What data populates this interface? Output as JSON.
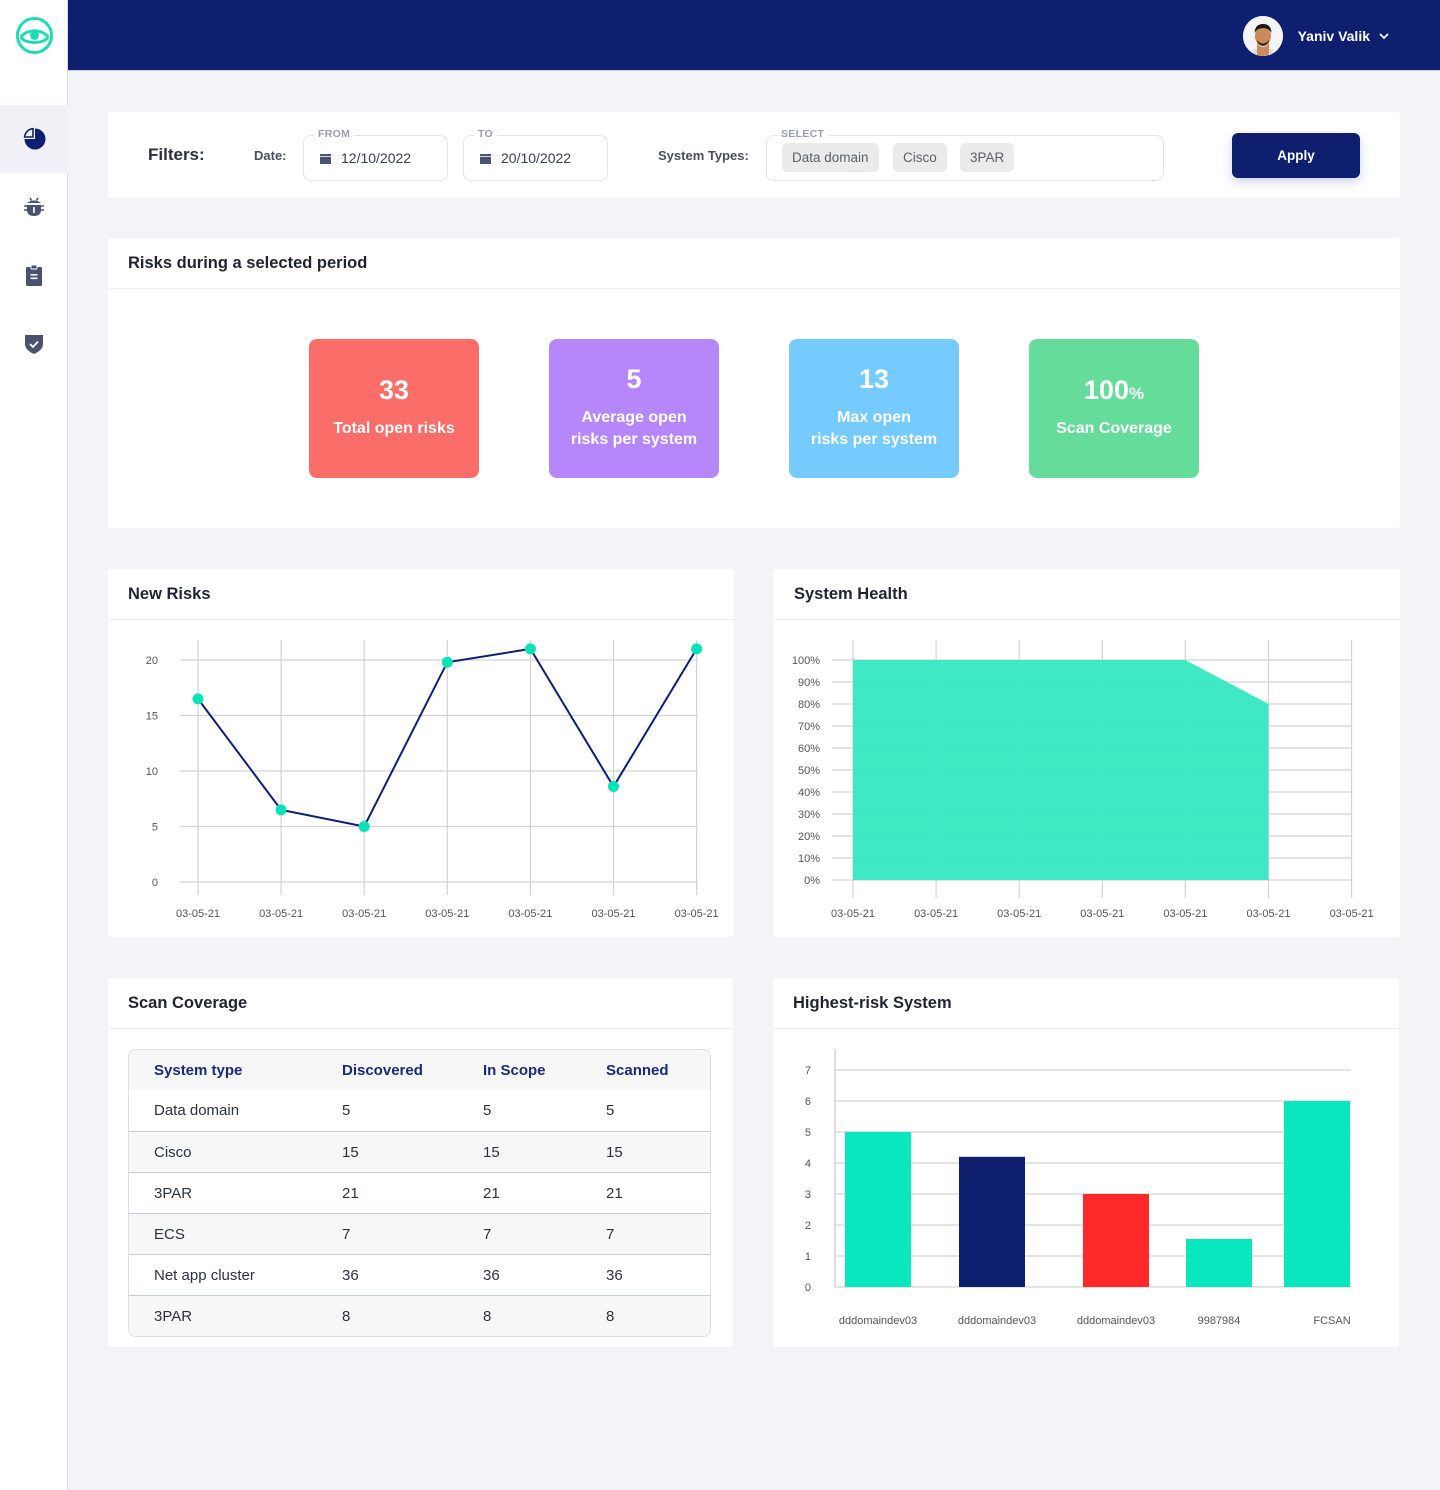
{
  "app": {
    "sidebar": {
      "items": [
        {
          "name": "dashboard",
          "icon": "pie-chart-icon",
          "active": true
        },
        {
          "name": "vulnerabilities",
          "icon": "bug-icon",
          "active": false
        },
        {
          "name": "reports",
          "icon": "clipboard-icon",
          "active": false
        },
        {
          "name": "compliance",
          "icon": "shield-check-icon",
          "active": false
        }
      ]
    },
    "user": {
      "name": "Yaniv Valik"
    }
  },
  "filters": {
    "title": "Filters:",
    "date_label": "Date:",
    "from_legend": "FROM",
    "from_value": "12/10/2022",
    "to_legend": "TO",
    "to_value": "20/10/2022",
    "system_types_label": "System Types:",
    "select_legend": "SELECT",
    "chips": [
      "Data domain",
      "Cisco",
      "3PAR"
    ],
    "apply_label": "Apply"
  },
  "risks": {
    "title": "Risks during a selected period",
    "stats": [
      {
        "value": "33",
        "unit": "",
        "label_line1": "Total open risks",
        "label_line2": "",
        "color": "#fa6d68"
      },
      {
        "value": "5",
        "unit": "",
        "label_line1": "Average open",
        "label_line2": "risks per system",
        "color": "#b687fa"
      },
      {
        "value": "13",
        "unit": "",
        "label_line1": "Max open",
        "label_line2": "risks per system",
        "color": "#76cbfe"
      },
      {
        "value": "100",
        "unit": "%",
        "label_line1": "Scan Coverage",
        "label_line2": "",
        "color": "#66dc9a"
      }
    ]
  },
  "new_risks": {
    "title": "New Risks"
  },
  "system_health": {
    "title": "System Health"
  },
  "scan_coverage": {
    "title": "Scan Coverage",
    "columns": [
      "System type",
      "Discovered",
      "In Scope",
      "Scanned"
    ],
    "rows": [
      [
        "Data domain",
        "5",
        "5",
        "5"
      ],
      [
        "Cisco",
        "15",
        "15",
        "15"
      ],
      [
        "3PAR",
        "21",
        "21",
        "21"
      ],
      [
        "ECS",
        "7",
        "7",
        "7"
      ],
      [
        "Net app cluster",
        "36",
        "36",
        "36"
      ],
      [
        "3PAR",
        "8",
        "8",
        "8"
      ]
    ]
  },
  "highest_risk": {
    "title": "Highest-risk System"
  },
  "chart_data": [
    {
      "id": "new_risks",
      "type": "line",
      "title": "New Risks",
      "categories": [
        "03-05-21",
        "03-05-21",
        "03-05-21",
        "03-05-21",
        "03-05-21",
        "03-05-21",
        "03-05-21"
      ],
      "values": [
        16.5,
        6.5,
        5,
        19.8,
        21,
        8.6,
        21
      ],
      "yticks": [
        0,
        5,
        10,
        15,
        20
      ],
      "ylim": [
        0,
        20
      ],
      "grid": true,
      "line_color": "#0f1f70",
      "marker_color": "#08e2b8"
    },
    {
      "id": "system_health",
      "type": "area",
      "title": "System Health",
      "categories": [
        "03-05-21",
        "03-05-21",
        "03-05-21",
        "03-05-21",
        "03-05-21",
        "03-05-21",
        "03-05-21"
      ],
      "values": [
        100,
        100,
        100,
        100,
        100,
        80,
        null
      ],
      "yticks": [
        "0%",
        "10%",
        "20%",
        "30%",
        "40%",
        "50%",
        "60%",
        "70%",
        "80%",
        "90%",
        "100%"
      ],
      "ylim": [
        0,
        100
      ],
      "grid": true,
      "fill_color": "#38e8c2"
    },
    {
      "id": "highest_risk",
      "type": "bar",
      "title": "Highest-risk System",
      "categories": [
        "dddomaindev03",
        "dddomaindev03",
        "dddomaindev03",
        "9987984",
        "FCSAN"
      ],
      "values": [
        5,
        4.2,
        3,
        1.55,
        6
      ],
      "colors": [
        "#08e7bd",
        "#0f1f70",
        "#fe2a2a",
        "#08e7bd",
        "#08e7bd"
      ],
      "yticks": [
        0,
        1,
        2,
        3,
        4,
        5,
        6,
        7
      ],
      "ylim": [
        0,
        7
      ],
      "grid": true
    }
  ]
}
